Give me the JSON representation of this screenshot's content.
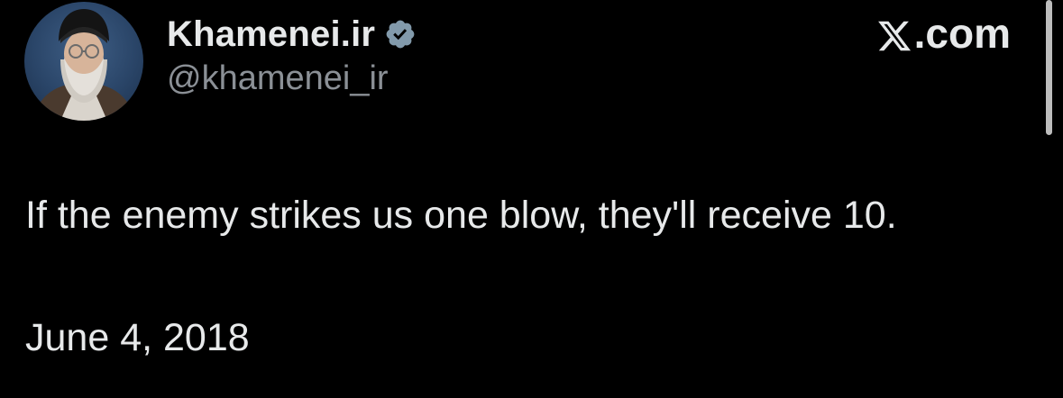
{
  "author": {
    "display_name": "Khamenei.ir",
    "handle": "@khamenei_ir",
    "verified_icon": "verified-badge-icon",
    "avatar_icon": "profile-avatar"
  },
  "brand": {
    "logo_icon": "x-logo-icon",
    "suffix": ".com"
  },
  "tweet": {
    "text": "If the enemy strikes us one blow, they'll receive 10.",
    "date": "June 4, 2018"
  },
  "colors": {
    "background": "#000000",
    "primary_text": "#e7e9ea",
    "secondary_text": "#8b9096",
    "verified_badge": "#829aab"
  }
}
